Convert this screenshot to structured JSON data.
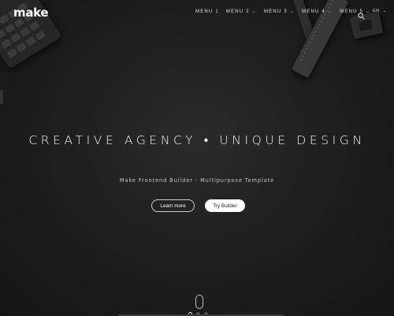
{
  "header": {
    "logo": "make",
    "nav": [
      {
        "label": "MENU 1",
        "has_dropdown": false
      },
      {
        "label": "MENU 2",
        "has_dropdown": true
      },
      {
        "label": "MENU 3",
        "has_dropdown": true
      },
      {
        "label": "MENU 4",
        "has_dropdown": true
      },
      {
        "label": "MENU 5",
        "has_dropdown": true
      }
    ],
    "search_icon": "search-icon",
    "language": "EN"
  },
  "hero": {
    "headline": "CREATIVE AGENCY • UNIQUE DESIGN",
    "subtitle": "Make Frontend Builder - Multipurpose Template",
    "primary_button": "Learn more",
    "secondary_button": "Try Builder"
  },
  "slider": {
    "dots": 3,
    "active_index": 0
  },
  "colors": {
    "background": "#1f1f1f",
    "text": "#ffffff",
    "button_light": "#ffffff"
  }
}
